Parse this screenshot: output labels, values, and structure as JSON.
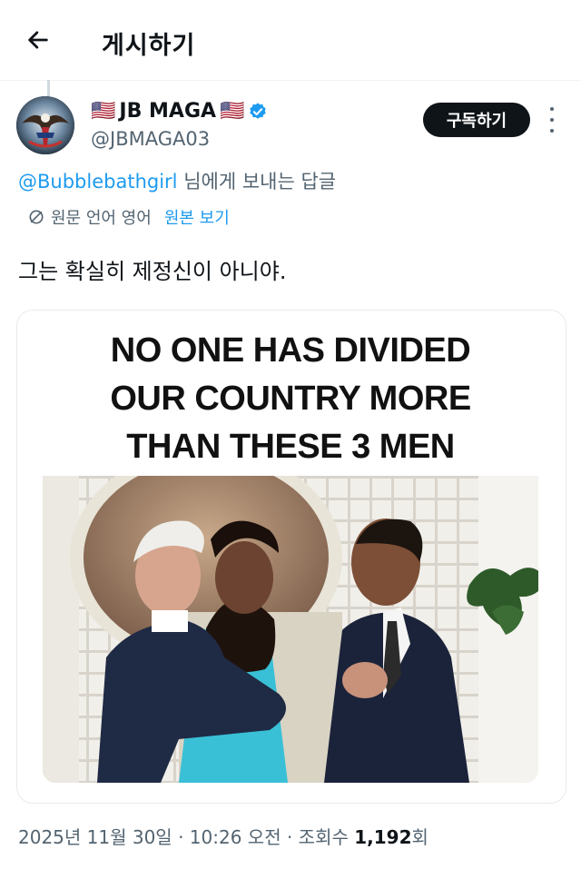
{
  "header": {
    "title": "게시하기",
    "back_icon": "arrow-left-icon"
  },
  "author": {
    "flag_left": "🇺🇸",
    "name": "JB MAGA",
    "flag_right": "🇺🇸",
    "verified_icon": "verified-badge-icon",
    "handle": "@JBMAGA03"
  },
  "subscribe_label": "구독하기",
  "reply_to": {
    "mention": "@Bubblebathgirl",
    "suffix": " 님에게 보내는 답글"
  },
  "translation": {
    "icon": "translate-icon",
    "info": "원문 언어 영어",
    "show_original": "원본 보기"
  },
  "tweet_text": "그는 확실히 제정신이 아니야.",
  "meme": {
    "line1": "NO ONE HAS DIVIDED",
    "line2": "OUR COUNTRY MORE",
    "line3": "THAN THESE 3 MEN"
  },
  "meta": {
    "date": "2025년 11월 30일",
    "sep1": " · ",
    "time": "10:26 오전",
    "sep2": " · ",
    "views_label": "조회수 ",
    "views_count": "1,192",
    "views_suffix": "회"
  },
  "colors": {
    "link": "#1d9bf0",
    "secondary_text": "#536471",
    "button_dark": "#0f1419"
  }
}
